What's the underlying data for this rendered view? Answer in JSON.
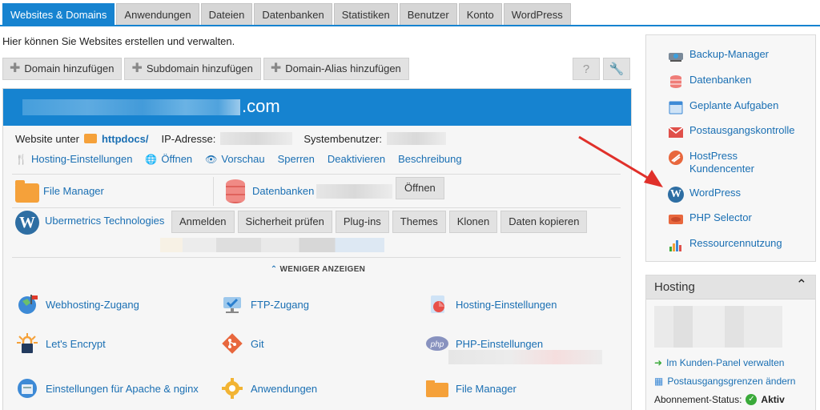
{
  "tabs": [
    "Websites & Domains",
    "Anwendungen",
    "Dateien",
    "Datenbanken",
    "Statistiken",
    "Benutzer",
    "Konto",
    "WordPress"
  ],
  "intro": "Hier können Sie Websites erstellen und verwalten.",
  "toolbar": {
    "add_domain": "Domain hinzufügen",
    "add_subdomain": "Subdomain hinzufügen",
    "add_alias": "Domain-Alias hinzufügen",
    "help_icon": "?",
    "settings_icon": "wrench-icon"
  },
  "domain": {
    "suffix": ".com",
    "website_at": "Website unter",
    "docroot": "httpdocs/",
    "ip_label": "IP-Adresse:",
    "sysuser_label": "Systembenutzer:",
    "actions": [
      "Hosting-Einstellungen",
      "Öffnen",
      "Vorschau",
      "Sperren",
      "Deaktivieren",
      "Beschreibung"
    ],
    "file_manager": "File Manager",
    "databases": "Datenbanken",
    "open_button": "Öffnen",
    "wp_site": "Ubermetrics Technologies",
    "wp_buttons": [
      "Anmelden",
      "Sicherheit prüfen",
      "Plug-ins",
      "Themes",
      "Klonen",
      "Daten kopieren"
    ],
    "show_less": "WENIGER ANZEIGEN",
    "tools": {
      "webhosting": "Webhosting-Zugang",
      "ftp": "FTP-Zugang",
      "hosting_settings": "Hosting-Einstellungen",
      "letsencrypt": "Let's Encrypt",
      "git": "Git",
      "php_settings": "PHP-Einstellungen",
      "apache": "Einstellungen für Apache & nginx",
      "apps": "Anwendungen",
      "file_manager": "File Manager"
    }
  },
  "sidebar": {
    "items": [
      "Backup-Manager",
      "Datenbanken",
      "Geplante Aufgaben",
      "Postausgangskontrolle",
      "HostPress Kundencenter",
      "WordPress",
      "PHP Selector",
      "Ressourcennutzung"
    ]
  },
  "hosting": {
    "title": "Hosting",
    "manage": "Im Kunden-Panel verwalten",
    "outgoing_limits": "Postausgangsgrenzen ändern",
    "status_label": "Abonnement-Status:",
    "status_value": "Aktiv"
  },
  "colors": {
    "accent": "#1683d0",
    "link": "#1a6fb3",
    "arrow": "#e0302a"
  }
}
